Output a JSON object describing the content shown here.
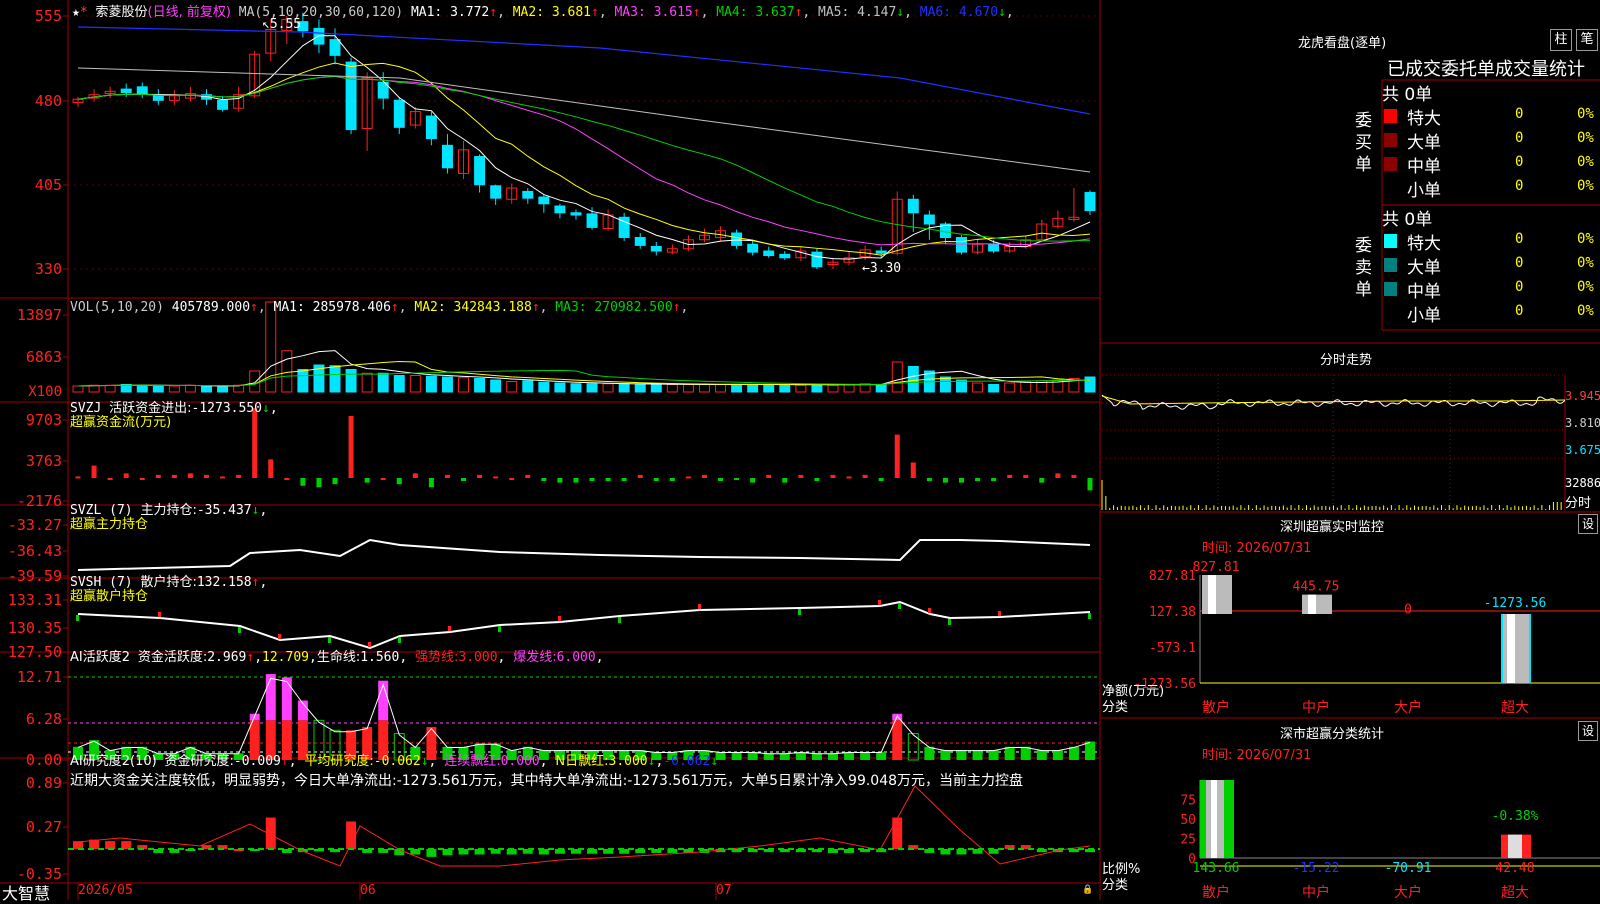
{
  "colors": {
    "red": "#ff2020",
    "cyan": "#00e5ff",
    "green": "#00d000",
    "magenta": "#ff40ff",
    "yellow": "#ffff00",
    "white": "#ffffff",
    "grid": "#8a0000",
    "blue": "#2030ff",
    "gray": "#c0c0c0",
    "orange": "#ff8040"
  },
  "main": {
    "title": "索菱股份",
    "period": "(日线, 前复权)",
    "ma_header": "MA(5,10,20,30,60,120)",
    "ma": [
      {
        "label": "MA1:",
        "value": "3.772",
        "arrow": "↑",
        "color": "#ffffff"
      },
      {
        "label": "MA2:",
        "value": "3.681",
        "arrow": "↑",
        "color": "#ffff00"
      },
      {
        "label": "MA3:",
        "value": "3.615",
        "arrow": "↑",
        "color": "#ff40ff"
      },
      {
        "label": "MA4:",
        "value": "3.637",
        "arrow": "↑",
        "color": "#00d000"
      },
      {
        "label": "MA5:",
        "value": "4.147",
        "arrow": "↓",
        "color": "#c0c0c0"
      },
      {
        "label": "MA6:",
        "value": "4.670",
        "arrow": "↓",
        "color": "#2030ff"
      }
    ],
    "y_ticks": [
      "555",
      "480",
      "405",
      "330"
    ],
    "high_label": "5.55",
    "low_label": "←3.30"
  },
  "vol": {
    "header": "VOL(5,10,20)",
    "value": "405789.000",
    "ma": [
      {
        "label": "MA1:",
        "value": "285978.406",
        "color": "#ffffff"
      },
      {
        "label": "MA2:",
        "value": "342843.188",
        "color": "#ffff00"
      },
      {
        "label": "MA3:",
        "value": "270982.500",
        "color": "#00d000"
      }
    ],
    "y_ticks": [
      "13897",
      "6863"
    ],
    "unit": "X100"
  },
  "svzj": {
    "header": "SVZJ",
    "text": "活跃资金进出:",
    "value": "-1273.550",
    "subtitle": "超赢资金流(万元)",
    "y_ticks": [
      "9703",
      "3763",
      "-2176"
    ]
  },
  "svzl": {
    "header": "SVZL (7)",
    "text": "主力持仓:",
    "value": "-35.437",
    "subtitle": "超赢主力持仓",
    "y_ticks": [
      "-33.27",
      "-36.43",
      "-39.59"
    ]
  },
  "svsh": {
    "header": "SVSH (7)",
    "text": "散户持仓:",
    "value": "132.158",
    "subtitle": "超赢散户持仓",
    "y_ticks": [
      "133.31",
      "130.35",
      "127.50"
    ]
  },
  "ai1": {
    "header": "AI活跃度2",
    "t1": "资金活跃度:",
    "v1": "2.969",
    "v2": "12.709",
    "t3": "生命线:",
    "v3": "1.560",
    "t4": "强势线:",
    "v4": "3.000",
    "t5": "爆发线:",
    "v5": "6.000",
    "y_ticks": [
      "12.71",
      "6.28",
      "0.00"
    ]
  },
  "ai2": {
    "header": "AI研究度2(10)",
    "t1": "资金研究度:",
    "v1": "-0.009",
    "t2": "平均研究度:",
    "v2": "-0.062",
    "t3": "连续飘红:",
    "v3": "0.000",
    "t4": "N日飘红:",
    "v4": "3.000",
    "v5": "-0.062",
    "y_ticks": [
      "0.89",
      "0.27",
      "-0.35"
    ],
    "note": "近期大资金关注度较低，明显弱势，今日大单净流出:-1273.561万元，其中特大单净流出:-1273.561万元，大单5日累计净入99.048万元，当前主力控盘"
  },
  "xaxis": {
    "brand": "大智慧",
    "labels": [
      "2026/05",
      "06",
      "07"
    ]
  },
  "lhb": {
    "title": "龙虎看盘(逐单)",
    "btns": [
      "柱",
      "笔"
    ],
    "header": "已成交委托单成交量统计",
    "buy": {
      "side": "委买单",
      "total": "共 0单",
      "rows": [
        {
          "label": "特大",
          "v": "0",
          "p": "0%",
          "c": "#ff0000"
        },
        {
          "label": "大单",
          "v": "0",
          "p": "0%",
          "c": "#8b0000"
        },
        {
          "label": "中单",
          "v": "0",
          "p": "0%",
          "c": "#8b0000"
        },
        {
          "label": "小单",
          "v": "0",
          "p": "0%",
          "c": ""
        }
      ]
    },
    "sell": {
      "side": "委卖单",
      "total": "共 0单",
      "rows": [
        {
          "label": "特大",
          "v": "0",
          "p": "0%",
          "c": "#00ffff"
        },
        {
          "label": "大单",
          "v": "0",
          "p": "0%",
          "c": "#008080"
        },
        {
          "label": "中单",
          "v": "0",
          "p": "0%",
          "c": "#008080"
        },
        {
          "label": "小单",
          "v": "0",
          "p": "0%",
          "c": ""
        }
      ]
    }
  },
  "intraday": {
    "title": "分时走势",
    "y_ticks": [
      "3.945",
      "3.810",
      "3.675"
    ],
    "vol_label": "32886",
    "bottom": "分时"
  },
  "monitor": {
    "title": "深圳超赢实时监控",
    "btn": "设",
    "time": "时间: 2026/07/31",
    "y_ticks": [
      "827.81",
      "127.38",
      "-573.1",
      "-1273.56"
    ],
    "values": [
      {
        "cat": "散户",
        "v": 827.81,
        "label": "827.81"
      },
      {
        "cat": "中户",
        "v": 445.75,
        "label": "445.75"
      },
      {
        "cat": "大户",
        "v": 0,
        "label": "0"
      },
      {
        "cat": "超大",
        "v": -1273.56,
        "label": "-1273.56"
      }
    ],
    "ylabel": "净额(万元)",
    "xlabel": "分类"
  },
  "classify": {
    "title": "深市超赢分类统计",
    "btn": "设",
    "time": "时间: 2026/07/31",
    "y_ticks": [
      "75",
      "50",
      "25",
      "0"
    ],
    "values": [
      {
        "cat": "散户",
        "v": 143.66,
        "label": "143.66"
      },
      {
        "cat": "中户",
        "v": -15.22,
        "label": "-15.22"
      },
      {
        "cat": "大户",
        "v": -70.91,
        "label": "-70.91"
      },
      {
        "cat": "超大",
        "v": 42.48,
        "label": "42.48"
      }
    ],
    "top_label": "-0.38%",
    "ylabel": "比例%",
    "xlabel": "分类"
  },
  "chart_data": {
    "type": "candlestick",
    "title": "索菱股份",
    "candles": [
      [
        4.78,
        4.81,
        4.83,
        4.74
      ],
      [
        4.82,
        4.85,
        4.9,
        4.79
      ],
      [
        4.86,
        4.88,
        4.92,
        4.82
      ],
      [
        4.9,
        4.87,
        4.95,
        4.83
      ],
      [
        4.92,
        4.86,
        4.96,
        4.82
      ],
      [
        4.84,
        4.8,
        4.9,
        4.76
      ],
      [
        4.8,
        4.84,
        4.89,
        4.76
      ],
      [
        4.82,
        4.86,
        4.92,
        4.79
      ],
      [
        4.85,
        4.81,
        4.9,
        4.76
      ],
      [
        4.8,
        4.72,
        4.84,
        4.7
      ],
      [
        4.73,
        4.85,
        4.92,
        4.7
      ],
      [
        4.84,
        5.21,
        5.24,
        4.82
      ],
      [
        5.22,
        5.43,
        5.52,
        5.15
      ],
      [
        5.42,
        5.52,
        5.55,
        5.3
      ],
      [
        5.5,
        5.42,
        5.58,
        5.36
      ],
      [
        5.44,
        5.3,
        5.52,
        5.22
      ],
      [
        5.34,
        5.2,
        5.44,
        5.12
      ],
      [
        5.14,
        4.54,
        5.18,
        4.5
      ],
      [
        4.55,
        5.0,
        5.05,
        4.35
      ],
      [
        4.96,
        4.82,
        5.05,
        4.72
      ],
      [
        4.8,
        4.56,
        4.83,
        4.5
      ],
      [
        4.58,
        4.7,
        4.74,
        4.55
      ],
      [
        4.66,
        4.46,
        4.7,
        4.4
      ],
      [
        4.4,
        4.2,
        4.5,
        4.15
      ],
      [
        4.15,
        4.36,
        4.44,
        4.1
      ],
      [
        4.3,
        4.05,
        4.32,
        3.98
      ],
      [
        4.04,
        3.93,
        4.05,
        3.87
      ],
      [
        3.92,
        4.02,
        4.06,
        3.88
      ],
      [
        3.99,
        3.93,
        4.02,
        3.88
      ],
      [
        3.94,
        3.88,
        3.96,
        3.8
      ],
      [
        3.86,
        3.8,
        3.88,
        3.75
      ],
      [
        3.8,
        3.78,
        3.83,
        3.74
      ],
      [
        3.79,
        3.67,
        3.85,
        3.65
      ],
      [
        3.66,
        3.78,
        3.83,
        3.64
      ],
      [
        3.76,
        3.58,
        3.8,
        3.55
      ],
      [
        3.58,
        3.51,
        3.62,
        3.48
      ],
      [
        3.5,
        3.46,
        3.54,
        3.42
      ],
      [
        3.45,
        3.48,
        3.52,
        3.43
      ],
      [
        3.48,
        3.56,
        3.6,
        3.46
      ],
      [
        3.56,
        3.6,
        3.66,
        3.54
      ],
      [
        3.58,
        3.64,
        3.68,
        3.55
      ],
      [
        3.62,
        3.51,
        3.65,
        3.48
      ],
      [
        3.52,
        3.45,
        3.56,
        3.42
      ],
      [
        3.46,
        3.42,
        3.5,
        3.4
      ],
      [
        3.43,
        3.4,
        3.46,
        3.38
      ],
      [
        3.4,
        3.46,
        3.5,
        3.37
      ],
      [
        3.45,
        3.32,
        3.48,
        3.3
      ],
      [
        3.34,
        3.36,
        3.4,
        3.3
      ],
      [
        3.36,
        3.4,
        3.46,
        3.33
      ],
      [
        3.41,
        3.47,
        3.51,
        3.38
      ],
      [
        3.46,
        3.44,
        3.5,
        3.4
      ],
      [
        3.44,
        3.92,
        3.99,
        3.42
      ],
      [
        3.92,
        3.8,
        3.96,
        3.63
      ],
      [
        3.78,
        3.7,
        3.82,
        3.56
      ],
      [
        3.7,
        3.58,
        3.72,
        3.52
      ],
      [
        3.58,
        3.45,
        3.6,
        3.43
      ],
      [
        3.45,
        3.52,
        3.56,
        3.43
      ],
      [
        3.52,
        3.46,
        3.56,
        3.44
      ],
      [
        3.46,
        3.5,
        3.54,
        3.44
      ],
      [
        3.5,
        3.56,
        3.6,
        3.48
      ],
      [
        3.56,
        3.7,
        3.74,
        3.54
      ],
      [
        3.68,
        3.75,
        3.82,
        3.66
      ],
      [
        3.74,
        3.76,
        4.02,
        3.72
      ],
      [
        3.98,
        3.82,
        4.0,
        3.78
      ]
    ],
    "ylim": [
      3.0,
      5.6
    ]
  }
}
